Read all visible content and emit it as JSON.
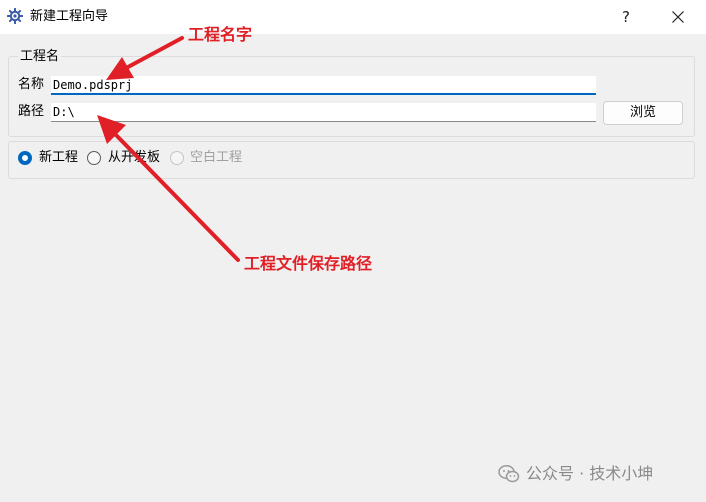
{
  "window": {
    "title": "新建工程向导",
    "help_label": "?"
  },
  "project_group": {
    "title": "工程名",
    "name_label": "名称",
    "name_value": "Demo.pdsprj",
    "path_label": "路径",
    "path_value": "D:\\",
    "browse_label": "浏览"
  },
  "options": {
    "items": [
      {
        "label": "新工程",
        "state": "checked"
      },
      {
        "label": "从开发板",
        "state": "unchecked"
      },
      {
        "label": "空白工程",
        "state": "disabled"
      }
    ]
  },
  "annotations": {
    "name_note": "工程名字",
    "path_note": "工程文件保存路径",
    "color": "#e11f26"
  },
  "watermark": {
    "text": "公众号 · 技术小坤"
  },
  "colors": {
    "accent": "#0067c0",
    "background": "#f0f0f0"
  }
}
